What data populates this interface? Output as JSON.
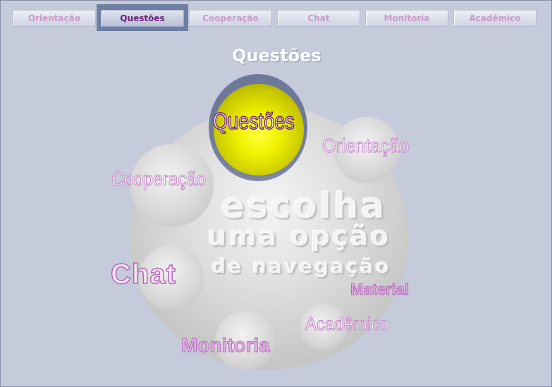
{
  "nav": {
    "tabs": [
      {
        "label": "Orientação"
      },
      {
        "label": "Questões"
      },
      {
        "label": "Cooperação"
      },
      {
        "label": "Chat"
      },
      {
        "label": "Monitoria"
      },
      {
        "label": "Acadêmico"
      }
    ],
    "active_tab": "Questões"
  },
  "page": {
    "title": "Questões"
  },
  "center": {
    "line1": "escolha",
    "line2": "uma opção",
    "line3": "de navegação"
  },
  "options": {
    "questoes": "Questões",
    "orientacao": "Orientação",
    "cooperacao": "Cooperação",
    "chat": "Chat",
    "material": "Material",
    "academico": "Acadêmico",
    "monitoria": "Monitoria"
  },
  "colors": {
    "background": "#c6cbdc",
    "active_tab_highlight": "#6d7fa2",
    "tab_text": "#c89ac9",
    "active_tab_text": "#6b1e7a",
    "selected_ball": "#f2f200",
    "option_outline": "#b06ab6"
  }
}
